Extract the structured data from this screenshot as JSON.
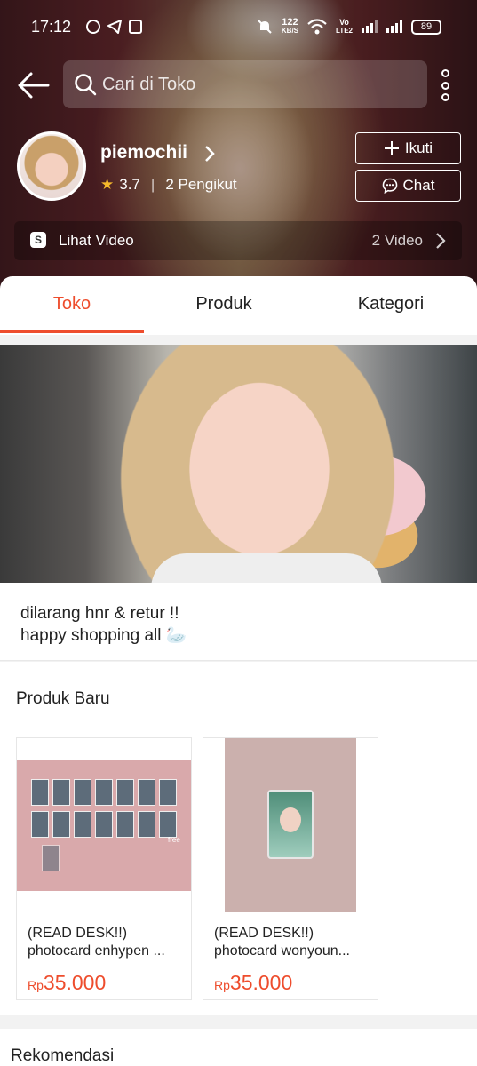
{
  "status_bar": {
    "time": "17:12",
    "speed_value": "122",
    "speed_unit": "KB/S",
    "network_label_1": "Vo",
    "network_label_2": "LTE2",
    "battery": "89"
  },
  "search": {
    "placeholder": "Cari di Toko"
  },
  "shop": {
    "name": "piemochii",
    "rating": "3.7",
    "followers": "2 Pengikut",
    "follow_label": "Ikuti",
    "chat_label": "Chat"
  },
  "video": {
    "label": "Lihat Video",
    "count": "2 Video"
  },
  "tabs": [
    {
      "label": "Toko",
      "active": true
    },
    {
      "label": "Produk",
      "active": false
    },
    {
      "label": "Kategori",
      "active": false
    }
  ],
  "description": {
    "line1": "dilarang hnr & retur !!",
    "line2": "happy shopping all 🦢"
  },
  "new_products": {
    "title": "Produk Baru",
    "items": [
      {
        "title_1": "(READ DESK!!)",
        "title_2": "photocard enhypen ...",
        "currency": "Rp",
        "price": "35.000",
        "free_tag": "free"
      },
      {
        "title_1": "(READ DESK!!)",
        "title_2": "photocard wonyoun...",
        "currency": "Rp",
        "price": "35.000"
      }
    ]
  },
  "recommendations": {
    "title": "Rekomendasi"
  },
  "colors": {
    "accent": "#ee4d2d",
    "star": "#f6b92b"
  },
  "icons": [
    "whatsapp-icon",
    "telegram-icon",
    "shop-icon",
    "mute-icon",
    "wifi-icon",
    "signal-icon",
    "battery-icon",
    "back-arrow-icon",
    "search-icon",
    "more-icon",
    "chevron-right-icon",
    "star-icon",
    "plus-icon",
    "chat-icon",
    "video-icon"
  ]
}
